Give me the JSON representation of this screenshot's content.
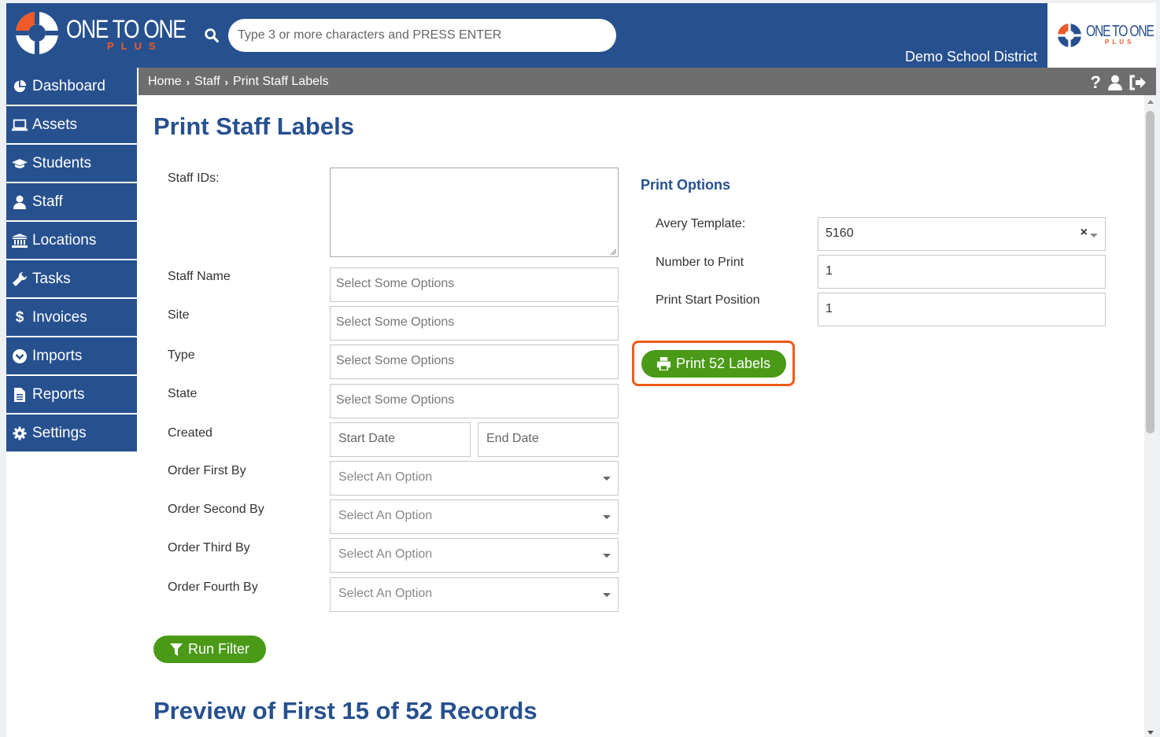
{
  "header": {
    "logo_text": "ONE TO ONE",
    "logo_sub": "PLUS",
    "search_placeholder": "Type 3 or more characters and PRESS ENTER",
    "district": "Demo School District",
    "colors": {
      "primary": "#27508f",
      "accent": "#f05a28",
      "green": "#4a9a17"
    }
  },
  "sidebar": {
    "items": [
      {
        "label": "Dashboard",
        "icon": "pie-chart-icon"
      },
      {
        "label": "Assets",
        "icon": "laptop-icon"
      },
      {
        "label": "Students",
        "icon": "graduation-cap-icon"
      },
      {
        "label": "Staff",
        "icon": "user-icon"
      },
      {
        "label": "Locations",
        "icon": "building-icon"
      },
      {
        "label": "Tasks",
        "icon": "wrench-icon"
      },
      {
        "label": "Invoices",
        "icon": "dollar-icon"
      },
      {
        "label": "Imports",
        "icon": "chevron-circle-down-icon"
      },
      {
        "label": "Reports",
        "icon": "file-icon"
      },
      {
        "label": "Settings",
        "icon": "gear-icon"
      }
    ]
  },
  "breadcrumb": {
    "home": "Home",
    "staff": "Staff",
    "current": "Print Staff Labels"
  },
  "page": {
    "title": "Print Staff Labels",
    "preview_title": "Preview of First 15 of 52 Records"
  },
  "filters": {
    "staff_ids_label": "Staff IDs:",
    "staff_name_label": "Staff Name",
    "site_label": "Site",
    "type_label": "Type",
    "state_label": "State",
    "created_label": "Created",
    "order_first_label": "Order First By",
    "order_second_label": "Order Second By",
    "order_third_label": "Order Third By",
    "order_fourth_label": "Order Fourth By",
    "multi_placeholder": "Select Some Options",
    "start_date_placeholder": "Start Date",
    "end_date_placeholder": "End Date",
    "single_placeholder": "Select An Option",
    "run_filter_label": "Run Filter"
  },
  "print_options": {
    "title": "Print Options",
    "avery_label": "Avery Template:",
    "avery_value": "5160",
    "clear_symbol": "×",
    "number_label": "Number to Print",
    "number_value": "1",
    "start_label": "Print Start Position",
    "start_value": "1",
    "print_button_label": "Print 52 Labels"
  }
}
